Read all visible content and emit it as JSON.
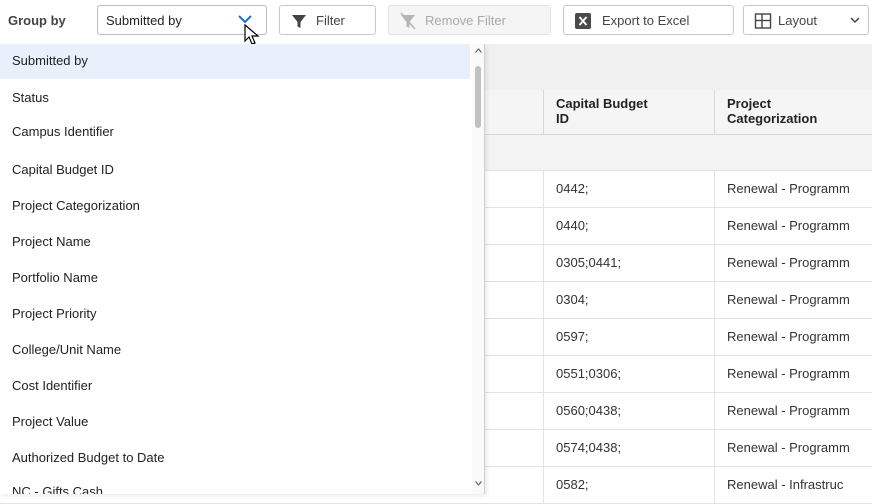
{
  "toolbar": {
    "group_by_label": "Group by",
    "group_by_value": "Submitted by",
    "filter_label": "Filter",
    "remove_filter_label": "Remove Filter",
    "export_label": "Export to Excel",
    "layout_label": "Layout"
  },
  "dropdown": {
    "options": [
      "Submitted by",
      "Status",
      "Campus Identifier",
      "Capital Budget ID",
      "Project Categorization",
      "Project Name",
      "Portfolio Name",
      "Project Priority",
      "College/Unit Name",
      "Cost Identifier",
      "Project Value",
      "Authorized Budget to Date",
      "NC - Gifts Cash"
    ],
    "selected": "Submitted by"
  },
  "grid": {
    "columns": [
      {
        "line1": "Capital Budget",
        "line2": "ID"
      },
      {
        "line1": "Project",
        "line2": "Categorization"
      }
    ],
    "rows": [
      {
        "id": "0442;",
        "cat": "Renewal - Programm"
      },
      {
        "id": "0440;",
        "cat": "Renewal - Programm"
      },
      {
        "id": "0305;0441;",
        "cat": "Renewal - Programm"
      },
      {
        "id": "0304;",
        "cat": "Renewal - Programm"
      },
      {
        "id": "0597;",
        "cat": "Renewal - Programm"
      },
      {
        "id": "0551;0306;",
        "cat": "Renewal - Programm"
      },
      {
        "id": "0560;0438;",
        "cat": "Renewal - Programm"
      },
      {
        "id": "0574;0438;",
        "cat": "Renewal - Programm"
      },
      {
        "id": "0582;",
        "cat": "Renewal - Infrastruc"
      }
    ]
  },
  "colors": {
    "accent": "#1a73c8",
    "selected_bg": "#e7f0fb",
    "export_icon_bg": "#4a4a4a"
  },
  "icons": {
    "chevron": "chevron-down-icon",
    "filter": "filter-icon",
    "remove_filter": "remove-filter-icon",
    "export": "excel-icon",
    "layout": "layout-grid-icon"
  }
}
